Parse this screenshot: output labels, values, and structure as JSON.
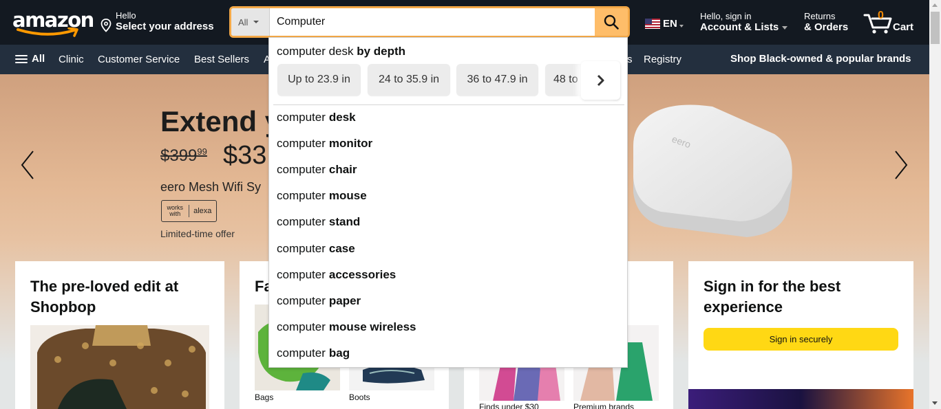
{
  "header": {
    "logo_text": "amazon",
    "deliver": {
      "line1": "Hello",
      "line2": "Select your address"
    },
    "search": {
      "category": "All",
      "query": "Computer"
    },
    "language": "EN",
    "account": {
      "line1": "Hello, sign in",
      "line2": "Account & Lists"
    },
    "orders": {
      "line1": "Returns",
      "line2": "& Orders"
    },
    "cart": {
      "count": "0",
      "label": "Cart"
    }
  },
  "nav": {
    "all_label": "All",
    "items": [
      "Clinic",
      "Customer Service",
      "Best Sellers",
      "A",
      "s",
      "Registry"
    ],
    "promo": "Shop Black-owned & popular brands"
  },
  "hero": {
    "title": "Extend y",
    "old_price": "$399",
    "old_price_cents": "99",
    "new_price": "$33",
    "subtitle": "eero Mesh Wifi Sy",
    "badge_left": "works with",
    "badge_right": "alexa",
    "offer": "Limited-time offer",
    "router_label": "eero"
  },
  "cards": [
    {
      "title": "The pre-loved edit at Shopbop"
    },
    {
      "title": "Fa",
      "captions": [
        "Bags",
        "Boots"
      ]
    },
    {
      "captions": [
        "Finds under $30",
        "Premium brands"
      ]
    },
    {
      "title": "Sign in for the best experience",
      "button": "Sign in securely"
    }
  ],
  "suggestions": {
    "header_prefix": "computer desk",
    "header_bold": "by depth",
    "chips": [
      "Up to 23.9 in",
      "24 to 35.9 in",
      "36 to 47.9 in",
      "48 to"
    ],
    "prefix": "computer",
    "items": [
      "desk",
      "monitor",
      "chair",
      "mouse",
      "stand",
      "case",
      "accessories",
      "paper",
      "mouse wireless",
      "bag"
    ]
  },
  "colors": {
    "header_bg": "#131921",
    "nav_bg": "#232f3e",
    "search_button": "#febd69",
    "search_border": "#f3a847",
    "cart_count": "#f08804",
    "signin_button": "#ffd814"
  }
}
